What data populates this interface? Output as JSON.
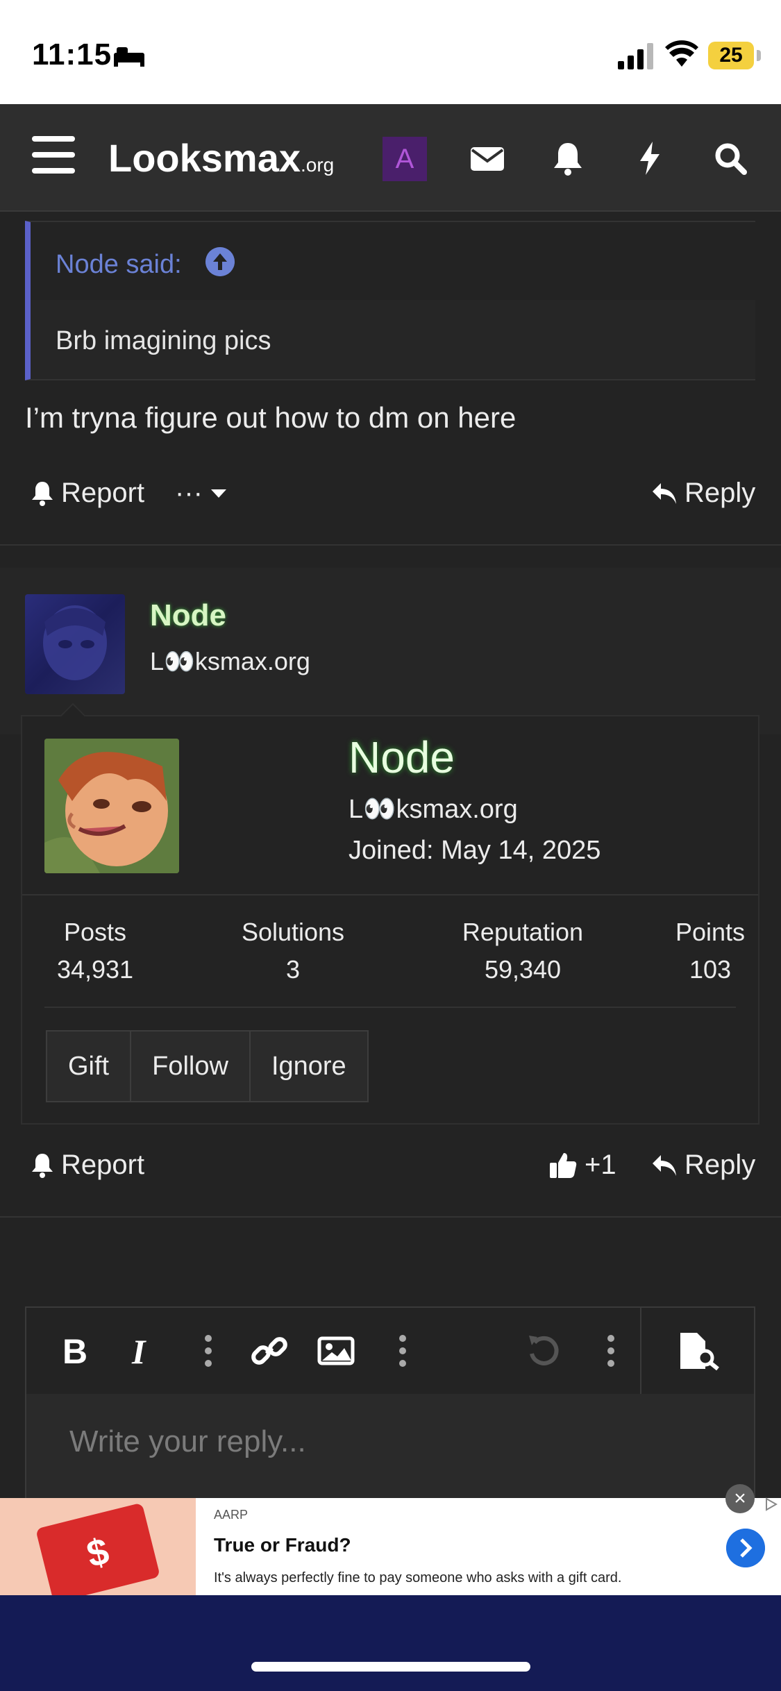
{
  "status_bar": {
    "time": "11:15",
    "battery": "25"
  },
  "nav": {
    "logo_main": "Looksmax",
    "logo_suffix": ".org",
    "account_initial": "A"
  },
  "quote": {
    "author": "Node said:",
    "text": "Brb imagining pics"
  },
  "message": {
    "text": "I’m tryna figure out how to dm on here"
  },
  "actions_1": {
    "report": "Report",
    "more": "···",
    "reply": "Reply"
  },
  "post": {
    "author": "Node",
    "user_title": "L👀ksmax.org"
  },
  "member_card": {
    "name": "Node",
    "user_title": "L👀ksmax.org",
    "joined": "Joined: May 14, 2025",
    "stats": [
      {
        "label": "Posts",
        "value": "34,931"
      },
      {
        "label": "Solutions",
        "value": "3"
      },
      {
        "label": "Reputation",
        "value": "59,340"
      },
      {
        "label": "Points",
        "value": "103"
      }
    ],
    "buttons": [
      "Gift",
      "Follow",
      "Ignore"
    ]
  },
  "actions_2": {
    "report": "Report",
    "like_count": "+1",
    "reply": "Reply"
  },
  "editor": {
    "placeholder": "Write your reply..."
  },
  "ad": {
    "brand": "AARP",
    "headline": "True or Fraud?",
    "body": "It's always perfectly fine to pay someone who asks with a gift card.",
    "card_symbol": "$"
  },
  "colors": {
    "accent": "#5b61c9",
    "quote_link": "#6b82d6",
    "username_glow": "#3aa53a",
    "bottom_bar": "#141b55",
    "ad_button": "#1e6fe0"
  }
}
